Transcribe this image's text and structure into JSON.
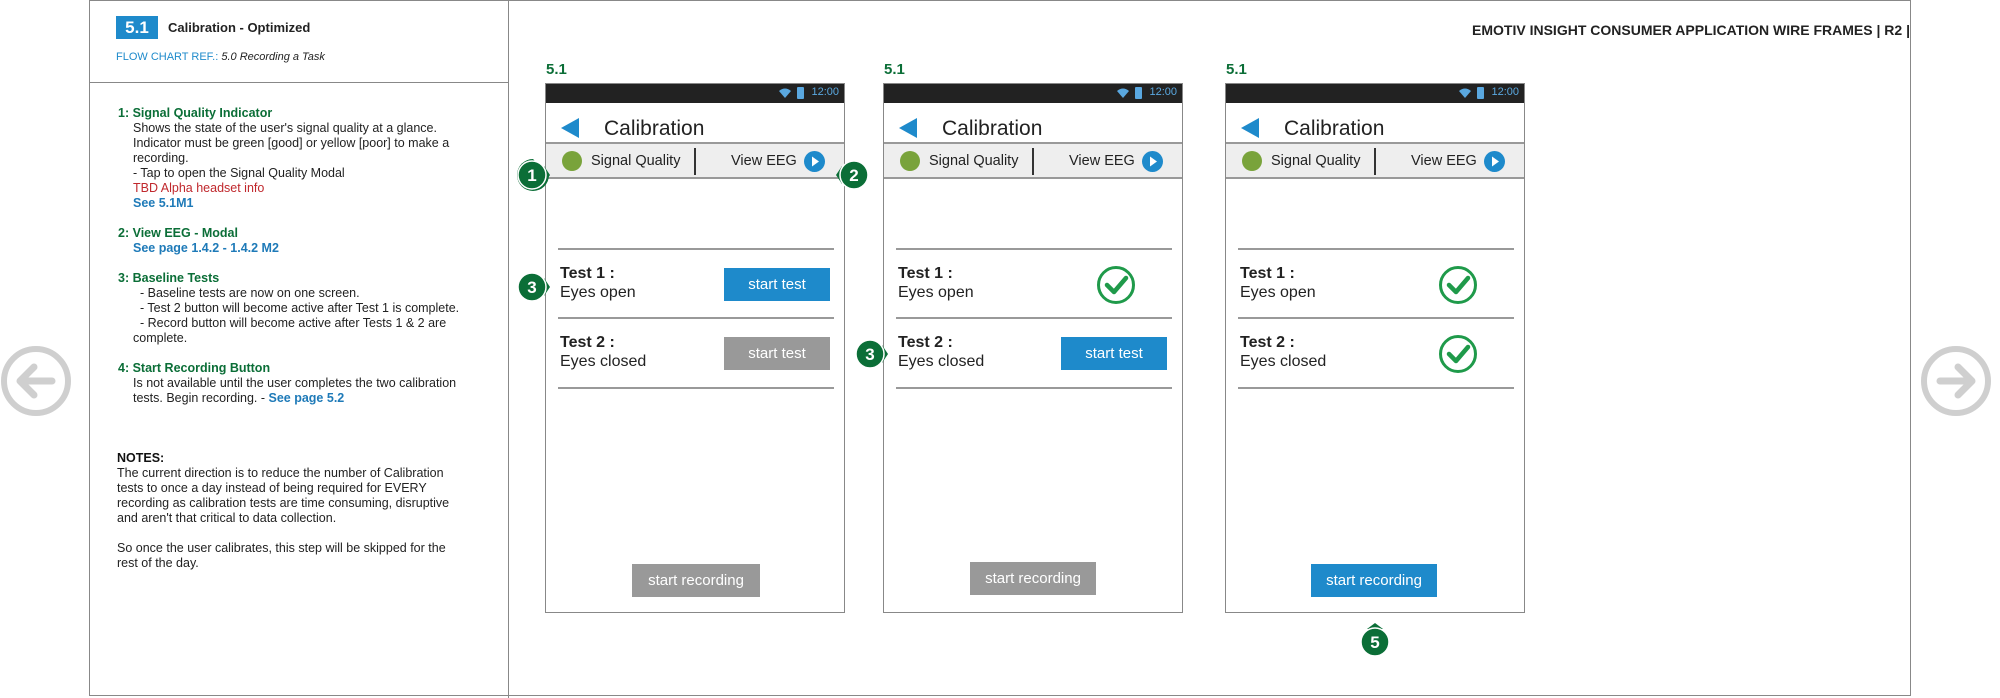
{
  "section": {
    "badge": "5.1",
    "title": "Calibration - Optimized",
    "flow_ref_label": "FLOW CHART REF.:",
    "flow_ref_value": "5.0  Recording a Task"
  },
  "doc_title": "EMOTIV INSIGHT CONSUMER APPLICATION WIRE FRAMES  | R2 |",
  "notes": [
    {
      "heading": "1: Signal Quality Indicator",
      "lines": [
        "Shows the state of the user's signal quality at a glance.",
        "Indicator must be green [good] or yellow [poor] to make a",
        "recording.",
        "- Tap  to open the Signal Quality Modal"
      ],
      "red_line": "TBD Alpha headset info",
      "link": "See 5.1M1"
    },
    {
      "heading": "2: View EEG - Modal",
      "link": "See page 1.4.2 - 1.4.2 M2"
    },
    {
      "heading": "3:  Baseline Tests",
      "lines": [
        "- Baseline tests are now on one screen.",
        "- Test 2 button will become active after Test 1 is complete.",
        "- Record button will become active after Tests 1 & 2 are",
        "complete."
      ]
    },
    {
      "heading": "4: Start Recording Button",
      "lines": [
        "Is not available until the user completes the two calibration",
        "tests. Begin recording. -"
      ],
      "link": "See page 5.2"
    }
  ],
  "notes_footer": {
    "heading": "NOTES:",
    "para1": [
      "The current direction is to reduce the number of Calibration",
      "tests to once a day instead of being required for EVERY",
      "recording as calibration tests are time consuming, disruptive",
      "and aren't that critical to data collection."
    ],
    "para2": [
      "So once the user calibrates, this step will be skipped for the",
      "rest of the day."
    ]
  },
  "nav": {
    "prev_icon": "arrow-left-circle-icon",
    "next_icon": "arrow-right-circle-icon"
  },
  "phones": [
    {
      "label": "5.1",
      "status_time": "12:00",
      "title": "Calibration",
      "signal_label": "Signal Quality",
      "eeg_label": "View EEG",
      "test1_title": "Test 1 :",
      "test1_sub": "Eyes open",
      "test1_action": "start test",
      "test1_state": "active",
      "test2_title": "Test 2 :",
      "test2_sub": "Eyes closed",
      "test2_action": "start test",
      "test2_state": "disabled",
      "record_label": "start recording",
      "record_state": "disabled"
    },
    {
      "label": "5.1",
      "status_time": "12:00",
      "title": "Calibration",
      "signal_label": "Signal Quality",
      "eeg_label": "View EEG",
      "test1_title": "Test 1 :",
      "test1_sub": "Eyes open",
      "test1_state": "complete",
      "test2_title": "Test 2 :",
      "test2_sub": "Eyes closed",
      "test2_action": "start test",
      "test2_state": "active",
      "record_label": "start recording",
      "record_state": "disabled"
    },
    {
      "label": "5.1",
      "status_time": "12:00",
      "title": "Calibration",
      "signal_label": "Signal Quality",
      "eeg_label": "View EEG",
      "test1_title": "Test 1 :",
      "test1_sub": "Eyes open",
      "test1_state": "complete",
      "test2_title": "Test 2 :",
      "test2_sub": "Eyes closed",
      "test2_state": "complete",
      "record_label": "start recording",
      "record_state": "active"
    }
  ],
  "markers": [
    "1",
    "2",
    "3",
    "3",
    "5"
  ],
  "colors": {
    "accent": "#1e8acb",
    "marker": "#0b6e37",
    "heading": "#0b6e37",
    "good_signal": "#79a33b",
    "check": "#1f9a4a",
    "disabled": "#999999"
  }
}
